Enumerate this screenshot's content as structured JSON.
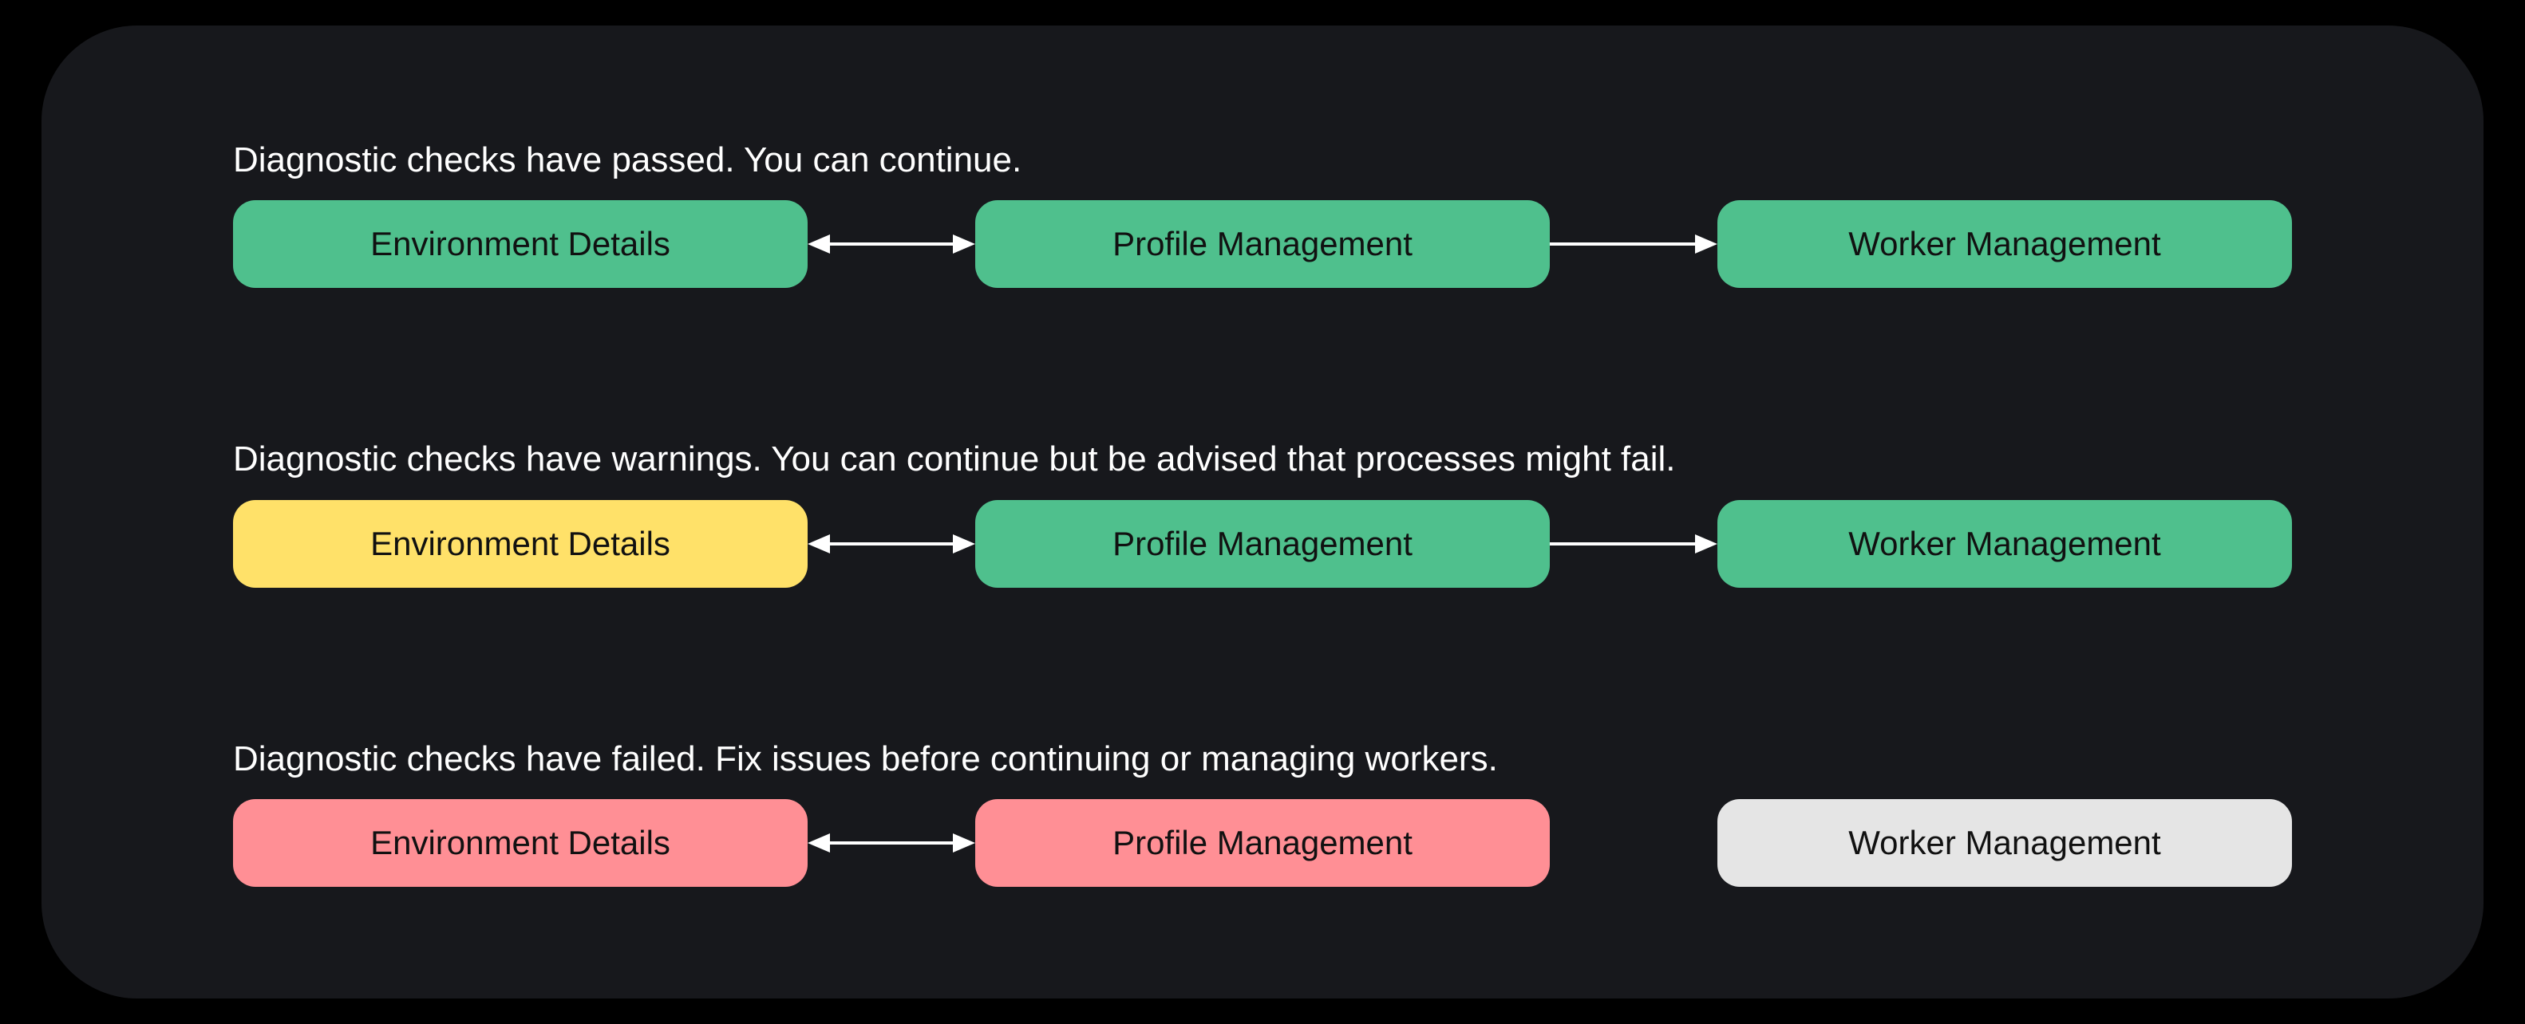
{
  "colors": {
    "green": "#4fc08d",
    "yellow": "#ffe169",
    "red": "#ff8f95",
    "gray": "#e5e5e5",
    "panel": "#17181c",
    "text": "#ffffff"
  },
  "node_labels": {
    "environment_details": "Environment Details",
    "profile_management": "Profile Management",
    "worker_management": "Worker Management"
  },
  "states": {
    "passed": {
      "caption": "Diagnostic checks have passed. You can continue.",
      "nodes": {
        "environment_details": "green",
        "profile_management": "green",
        "worker_management": "green"
      },
      "connectors": {
        "env_to_profile": "double",
        "profile_to_worker": "right"
      }
    },
    "warnings": {
      "caption": "Diagnostic checks have warnings. You can continue but be advised that processes might fail.",
      "nodes": {
        "environment_details": "yellow",
        "profile_management": "green",
        "worker_management": "green"
      },
      "connectors": {
        "env_to_profile": "double",
        "profile_to_worker": "right"
      }
    },
    "failed": {
      "caption": "Diagnostic checks have failed. Fix issues before continuing or managing workers.",
      "nodes": {
        "environment_details": "red",
        "profile_management": "red",
        "worker_management": "gray"
      },
      "connectors": {
        "env_to_profile": "double",
        "profile_to_worker": "none"
      }
    }
  }
}
